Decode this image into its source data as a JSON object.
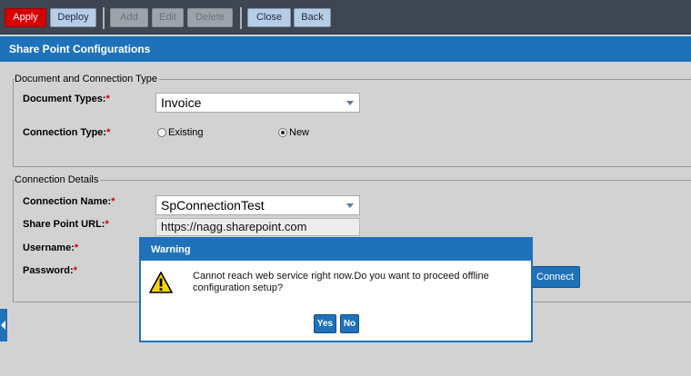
{
  "toolbar": {
    "apply": "Apply",
    "deploy": "Deploy",
    "add": "Add",
    "edit": "Edit",
    "delete": "Delete",
    "close": "Close",
    "back": "Back"
  },
  "header": {
    "title": "Share Point Configurations"
  },
  "doc_section": {
    "legend": "Document and Connection Type",
    "doc_types_label": "Document Types:",
    "doc_types_value": "Invoice",
    "conn_type_label": "Connection Type:",
    "radio_existing": "Existing",
    "radio_new": "New",
    "selected_radio": "New"
  },
  "conn_section": {
    "legend": "Connection Details",
    "conn_name_label": "Connection Name:",
    "conn_name_value": "SpConnectionTest",
    "url_label": "Share Point URL:",
    "url_value": "https://nagg.sharepoint.com",
    "username_label": "Username:",
    "password_label": "Password:",
    "connect": "Connect"
  },
  "required_marker": "*",
  "dialog": {
    "title": "Warning",
    "message": "Cannot reach web service right now.Do you want to proceed offline configuration setup?",
    "yes": "Yes",
    "no": "No"
  },
  "colors": {
    "accent": "#1f72ba",
    "apply": "#d60000",
    "toolbar": "#3e4652",
    "required": "#d40000"
  }
}
